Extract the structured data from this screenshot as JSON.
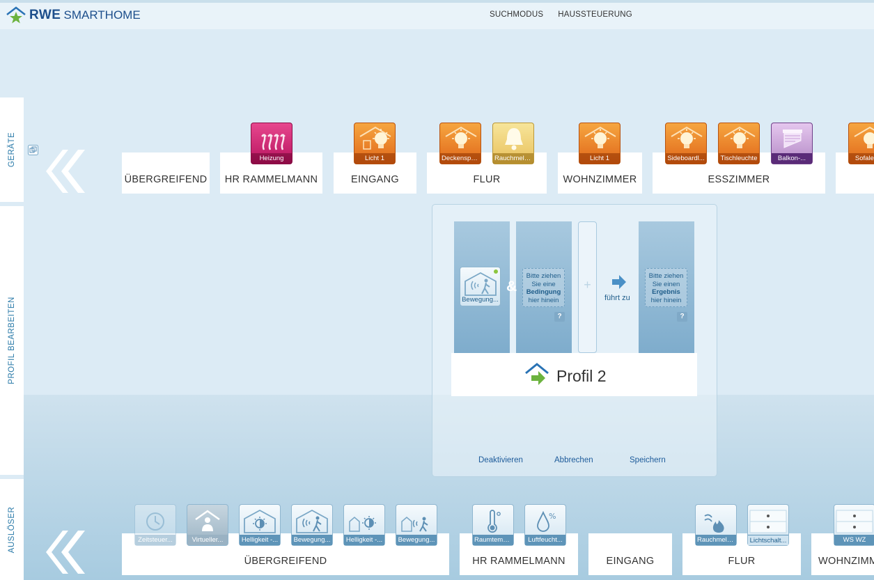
{
  "header": {
    "brand_rwe": "RWE",
    "brand_sub": "SMARTHOME",
    "nav": [
      "SUCHMODUS",
      "HAUSSTEUERUNG"
    ]
  },
  "sidebar": {
    "tabs": [
      "GERÄTE",
      "PROFIL BEARBEITEN",
      "AUSLÖSER"
    ]
  },
  "devices": {
    "rooms": [
      "ÜBERGREIFEND",
      "HR RAMMELMANN",
      "EINGANG",
      "FLUR",
      "WOHNZIMMER",
      "ESSZIMMER"
    ],
    "tiles": [
      {
        "label": "Heizung",
        "icon": "heating-icon",
        "color": "#c8196a"
      },
      {
        "label": "Licht 1",
        "icon": "bulb-icon",
        "color": "#e9781f"
      },
      {
        "label": "Deckenspots",
        "icon": "bulb-icon",
        "color": "#e9781f"
      },
      {
        "label": "Rauchmeld...",
        "icon": "bell-icon",
        "color": "#e9c35a"
      },
      {
        "label": "Licht 1",
        "icon": "bulb-icon",
        "color": "#e9781f"
      },
      {
        "label": "Sideboardl...",
        "icon": "bulb-icon",
        "color": "#e9781f"
      },
      {
        "label": "Tischleuchte",
        "icon": "bulb-icon",
        "color": "#e9781f"
      },
      {
        "label": "Balkon-...",
        "icon": "shutter-icon",
        "color": "#b48ac6"
      },
      {
        "label": "Sofaleu...",
        "icon": "bulb-icon",
        "color": "#e9781f"
      }
    ]
  },
  "profile": {
    "condition_tile": "Bewegung...",
    "and_symbol": "&",
    "plus_symbol": "+",
    "drop_condition": {
      "line1": "Bitte ziehen",
      "line2": "Sie eine",
      "bold": "Bedingung",
      "line3": "hier hinein"
    },
    "leads_to": "führt zu",
    "drop_result": {
      "line1": "Bitte ziehen",
      "line2": "Sie einen",
      "bold": "Ergebnis",
      "line3": "hier hinein"
    },
    "help": "?",
    "name": "Profil 2",
    "buttons": {
      "deactivate": "Deaktivieren",
      "cancel": "Abbrechen",
      "save": "Speichern"
    }
  },
  "triggers": {
    "rooms": [
      "ÜBERGREIFEND",
      "HR RAMMELMANN",
      "EINGANG",
      "FLUR",
      "WOHNZIMM"
    ],
    "tiles": [
      {
        "label": "Zeitsteuer...",
        "icon": "clock-icon"
      },
      {
        "label": "Virtueller...",
        "icon": "virtual-resident-icon"
      },
      {
        "label": "Helligkeit -...",
        "icon": "brightness-icon"
      },
      {
        "label": "Bewegung...",
        "icon": "motion-icon"
      },
      {
        "label": "Helligkeit -...",
        "icon": "brightness-icon"
      },
      {
        "label": "Bewegung...",
        "icon": "motion-icon"
      },
      {
        "label": "Raumtemp...",
        "icon": "thermometer-icon"
      },
      {
        "label": "Luftfeucht...",
        "icon": "humidity-icon"
      },
      {
        "label": "Rauchmeld...",
        "icon": "smoke-flame-icon"
      },
      {
        "label": "Lichtschalt...",
        "icon": "switch-icon"
      },
      {
        "label": "WS WZ",
        "icon": "switch-icon"
      }
    ]
  }
}
